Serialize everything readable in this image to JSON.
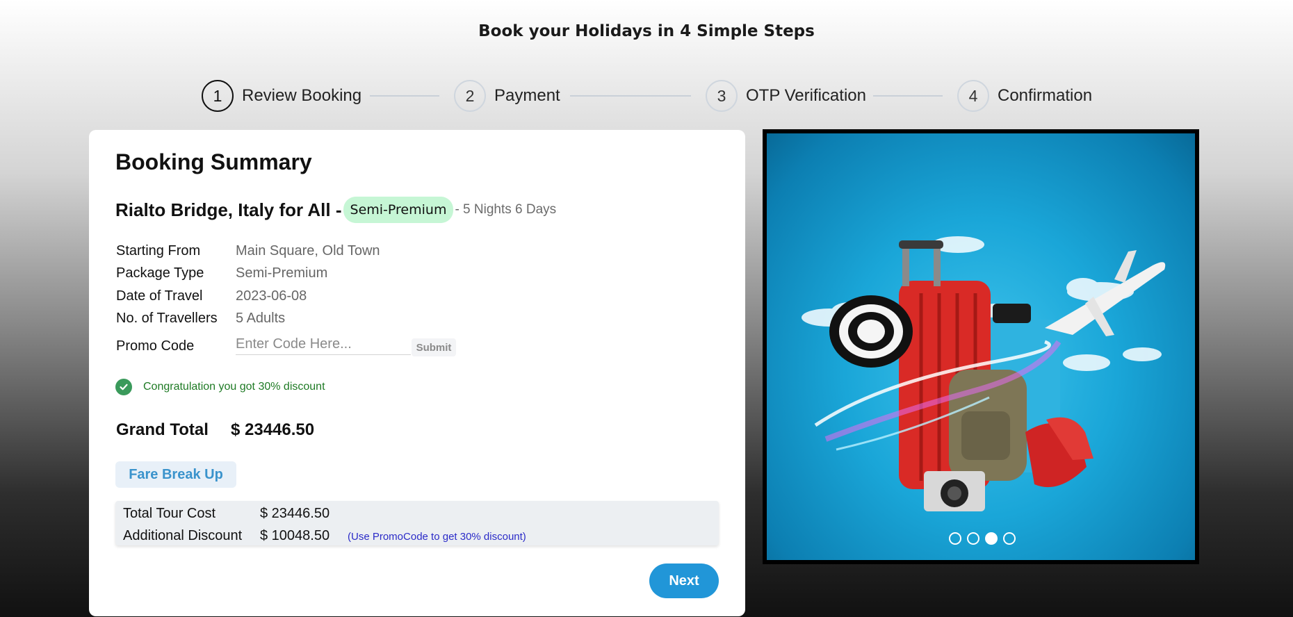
{
  "page": {
    "title": "Book your Holidays in 4 Simple Steps"
  },
  "steps": [
    {
      "number": "1",
      "label": "Review Booking",
      "active": true
    },
    {
      "number": "2",
      "label": "Payment",
      "active": false
    },
    {
      "number": "3",
      "label": "OTP Verification",
      "active": false
    },
    {
      "number": "4",
      "label": "Confirmation",
      "active": false
    }
  ],
  "summary": {
    "title": "Booking Summary",
    "package_name": "Rialto Bridge, Italy for All -",
    "package_badge": "Semi-Premium",
    "duration": "- 5 Nights 6 Days",
    "details": [
      {
        "label": "Starting From",
        "value": "Main Square, Old Town"
      },
      {
        "label": "Package Type",
        "value": "Semi-Premium"
      },
      {
        "label": "Date of Travel",
        "value": "2023-06-08"
      },
      {
        "label": "No. of Travellers",
        "value": "5 Adults"
      }
    ],
    "promo": {
      "label": "Promo Code",
      "placeholder": "Enter Code Here...",
      "value": "",
      "submit_label": "Submit"
    },
    "success_message": "Congratulation you got 30% discount",
    "grand_total_label": "Grand Total",
    "grand_total_value": "$ 23446.50",
    "fare_breakup_label": "Fare Break Up",
    "fare": [
      {
        "label": "Total Tour Cost",
        "value": "$ 23446.50"
      },
      {
        "label": "Additional Discount",
        "value": "$ 10048.50",
        "note": "(Use PromoCode to get 30% discount)"
      }
    ],
    "next_label": "Next"
  },
  "carousel": {
    "image_icon": "travel-luggage-image",
    "slide_count": 4,
    "active_index": 2
  },
  "colors": {
    "accent": "#2196d8",
    "badge_bg": "#c6f6d5",
    "success": "#3a9a5b",
    "note": "#2b2bc8"
  }
}
